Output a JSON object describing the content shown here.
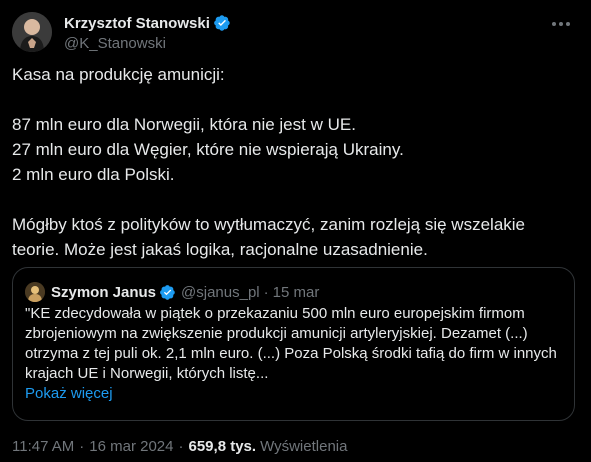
{
  "author": {
    "display_name": "Krzysztof Stanowski",
    "handle": "@K_Stanowski",
    "avatar_icon": "person-avatar",
    "verified_icon": "verified-badge-icon"
  },
  "tweet": {
    "paragraphs": [
      "Kasa na produkcję amunicji:",
      "87 mln euro dla Norwegii, która nie jest w UE.",
      "27 mln euro dla Węgier, które nie wspierają Ukrainy.",
      "2 mln euro dla Polski.",
      "Mógłby ktoś z polityków to wytłumaczyć, zanim rozleją się wszelakie teorie. Może jest jakaś logika, racjonalne uzasadnienie."
    ]
  },
  "quote": {
    "display_name": "Szymon Janus",
    "handle": "@sjanus_pl",
    "separator": "·",
    "date": "15 mar",
    "text": "\"KE zdecydowała w piątek o przekazaniu 500 mln euro europejskim firmom zbrojeniowym na zwiększenie produkcji amunicji artyleryjskiej. Dezamet (...) otrzyma z tej puli ok. 2,1 mln euro. (...) Poza Polską środki tafią do firm w innych krajach UE i Norwegii, których listę...",
    "show_more": "Pokaż więcej"
  },
  "meta": {
    "time": "11:47 AM",
    "dot1": "·",
    "date": "16 mar 2024",
    "dot2": "·",
    "views_count": "659,8 tys.",
    "views_label": "Wyświetlenia"
  },
  "colors": {
    "background": "#000000",
    "text": "#e7e9ea",
    "secondary": "#71767b",
    "accent": "#1d9bf0",
    "border": "#2f3336"
  }
}
